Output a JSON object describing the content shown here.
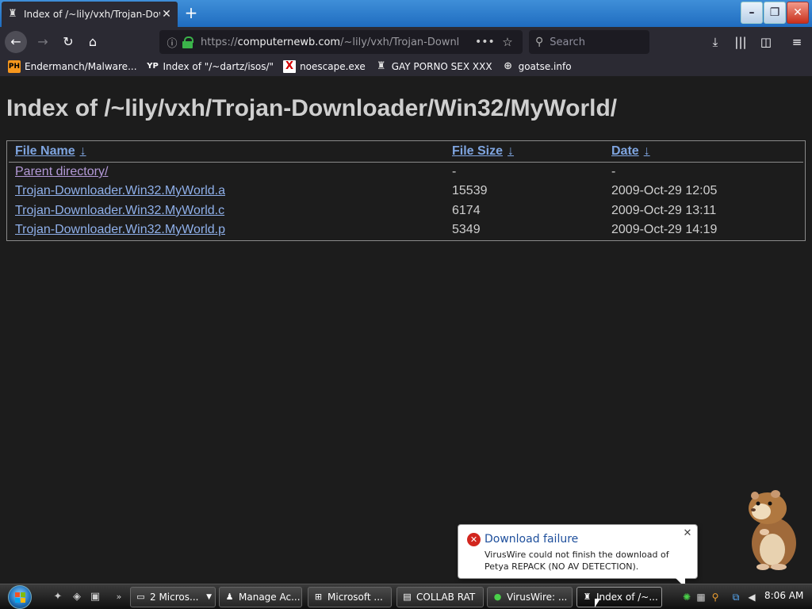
{
  "browser": {
    "tab_title": "Index of /~lily/vxh/Trojan-Dow",
    "url_scheme": "https://",
    "url_host": "computernewb.com",
    "url_path": "/~lily/vxh/Trojan-Downl",
    "search_placeholder": "Search"
  },
  "icons": {
    "back": "←",
    "forward": "→",
    "reload": "↻",
    "home": "⌂",
    "more": "•••",
    "star": "☆",
    "search": "⚲",
    "download": "⤓",
    "library": "|||",
    "sidebar": "◫",
    "menu": "≡",
    "close": "✕",
    "plus": "+"
  },
  "bookmarks": [
    {
      "label": "Endermanch/Malware...",
      "badge": "PH"
    },
    {
      "label": "Index of \"/~dartz/isos/\"",
      "badge": "YP"
    },
    {
      "label": "noescape.exe",
      "badge": "X"
    },
    {
      "label": "GAY PORNO SEX XXX",
      "badge": ""
    },
    {
      "label": "goatse.info",
      "badge": ""
    }
  ],
  "page": {
    "title": "Index of /~lily/vxh/Trojan-Downloader/Win32/MyWorld/",
    "headers": {
      "name": "File Name",
      "size": "File Size",
      "date": "Date",
      "arrow": "↓"
    },
    "rows": [
      {
        "name": "Parent directory/",
        "size": "-",
        "date": "-"
      },
      {
        "name": "Trojan-Downloader.Win32.MyWorld.a",
        "size": "15539",
        "date": "2009-Oct-29 12:05"
      },
      {
        "name": "Trojan-Downloader.Win32.MyWorld.c",
        "size": "6174",
        "date": "2009-Oct-29 13:11"
      },
      {
        "name": "Trojan-Downloader.Win32.MyWorld.p",
        "size": "5349",
        "date": "2009-Oct-29 14:19"
      }
    ]
  },
  "notification": {
    "title": "Download failure",
    "message": "VirusWire could not finish the download of Petya REPACK (NO AV DETECTION)."
  },
  "taskbar": {
    "tasks": [
      {
        "label": "2 Micros..."
      },
      {
        "label": "Manage Ac..."
      },
      {
        "label": "Microsoft ..."
      },
      {
        "label": "COLLAB RAT"
      },
      {
        "label": "VirusWire: ..."
      },
      {
        "label": "Index of /~..."
      }
    ],
    "more": "»",
    "clock": "8:06 AM"
  },
  "colors": {
    "accent_link": "#8fb0ea",
    "visited_link": "#b49ad8",
    "error": "#d2261e",
    "lock": "#3bb34a"
  }
}
